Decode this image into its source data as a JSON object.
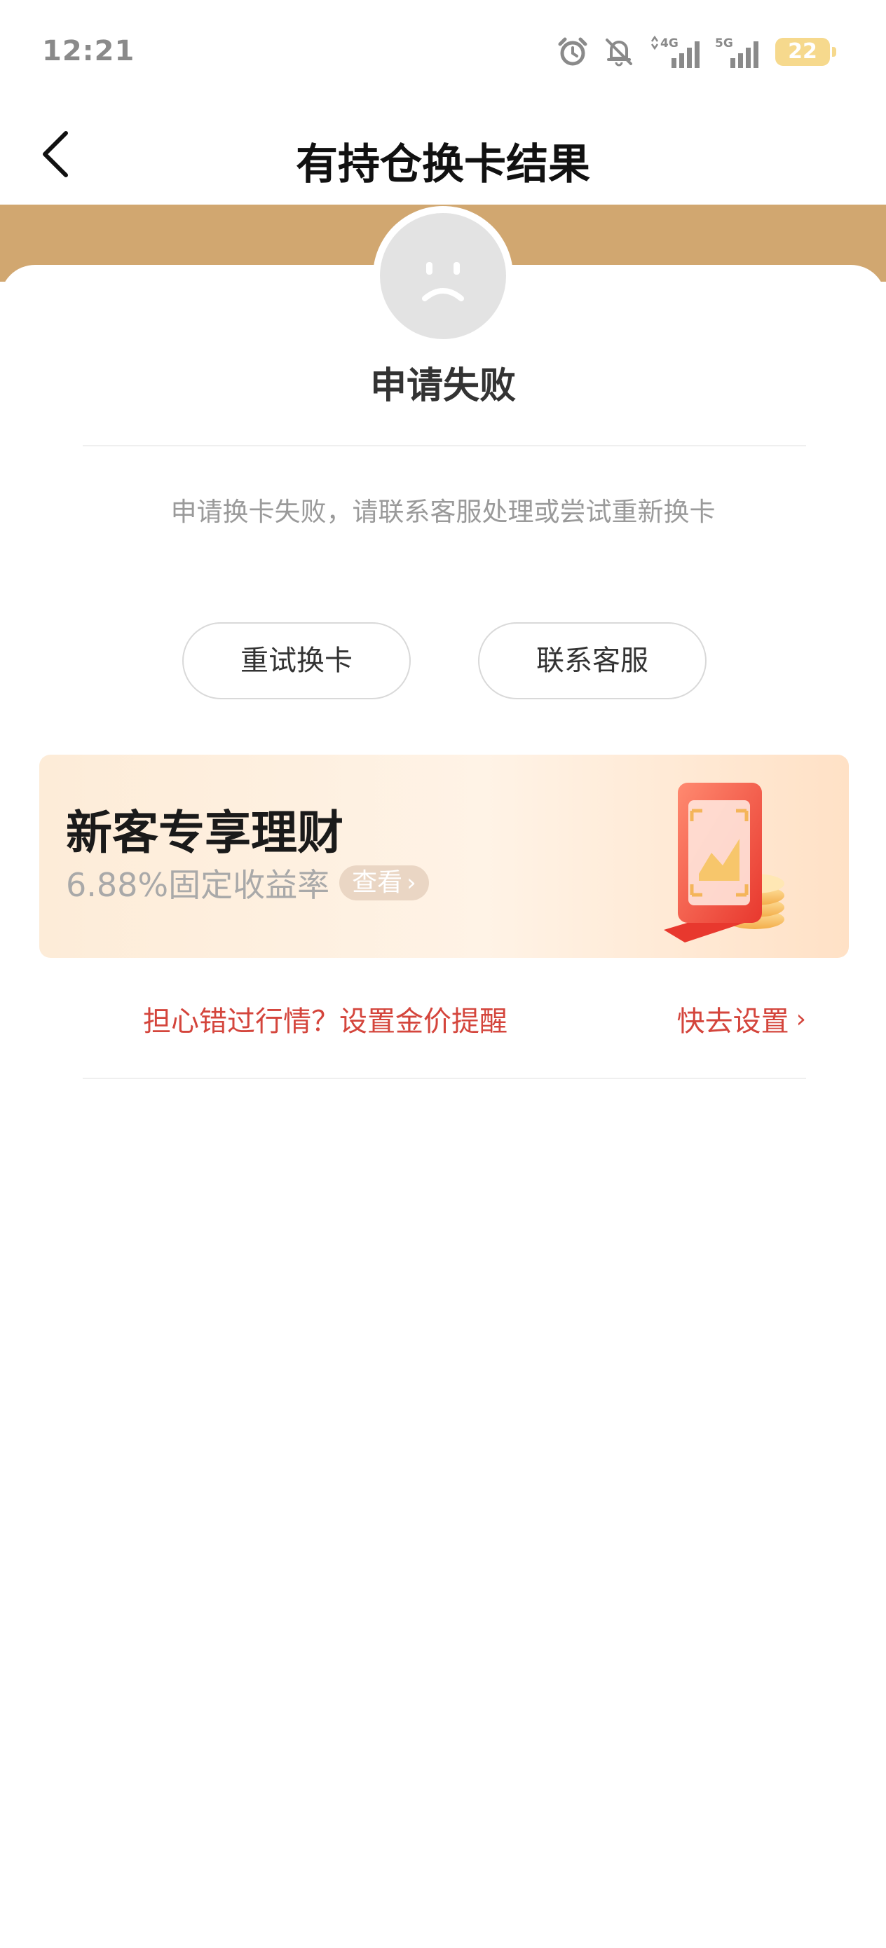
{
  "status_bar": {
    "time": "12:21",
    "icons": [
      "alarm-icon",
      "mute-icon",
      "4g-signal-icon",
      "5g-signal-icon",
      "battery-icon"
    ],
    "network_1": "4G",
    "network_2": "5G",
    "battery_level": "22"
  },
  "nav": {
    "back_icon": "chevron-left-icon",
    "title": "有持仓换卡结果"
  },
  "result": {
    "icon": "sad-face-icon",
    "title": "申请失败",
    "description": "申请换卡失败，请联系客服处理或尝试重新换卡"
  },
  "actions": {
    "retry_label": "重试换卡",
    "contact_label": "联系客服"
  },
  "promo": {
    "title": "新客专享理财",
    "subtitle": "6.88%固定收益率",
    "view_label": "查看",
    "view_chevron": "›",
    "illustration": "finance-card-coins-icon"
  },
  "price_alert": {
    "text": "担心错过行情？设置金价提醒",
    "action_label": "快去设置",
    "action_chevron": "›"
  },
  "colors": {
    "accent_gold": "#d1a770",
    "alert_red": "#d4453c",
    "battery_yellow": "#f6d98d"
  }
}
